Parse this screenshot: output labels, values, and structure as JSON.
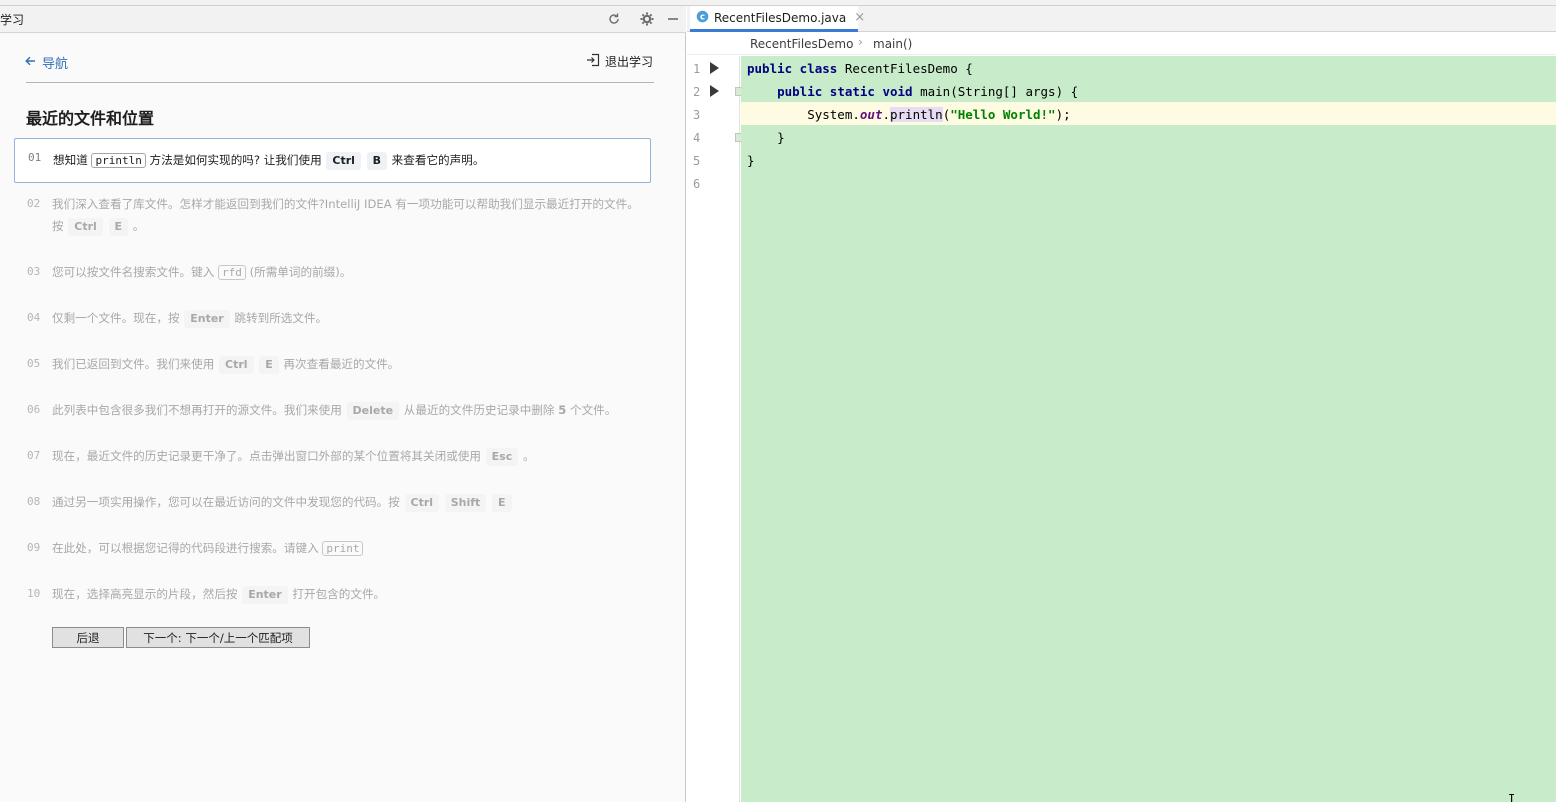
{
  "learn": {
    "panel_title": "学习",
    "nav_back": "导航",
    "exit": "退出学习",
    "lesson_title": "最近的文件和位置",
    "steps": [
      {
        "num": "01"
      },
      {
        "num": "02",
        "text_a": "我们深入查看了库文件。怎样才能返回到我们的文件?IntelliJ IDEA 有一项功能可以帮助我们显示最近打开的文件。按",
        "k1": "Ctrl",
        "k2": "E",
        "text_b": "。"
      },
      {
        "num": "03",
        "text_a": "您可以按文件名搜索文件。键入",
        "code": "rfd",
        "text_b": "(所需单词的前缀)。"
      },
      {
        "num": "04",
        "text_a": "仅剩一个文件。现在，按",
        "k1": "Enter",
        "text_b": "跳转到所选文件。"
      },
      {
        "num": "05",
        "text_a": "我们已返回到文件。我们来使用",
        "k1": "Ctrl",
        "k2": "E",
        "text_b": "再次查看最近的文件。"
      },
      {
        "num": "06",
        "text_a": "此列表中包含很多我们不想再打开的源文件。我们来使用",
        "k1": "Delete",
        "text_b": "从最近的文件历史记录中删除",
        "bold": "5",
        "text_c": "个文件。"
      },
      {
        "num": "07",
        "text_a": "现在，最近文件的历史记录更干净了。点击弹出窗口外部的某个位置将其关闭或使用",
        "k1": "Esc",
        "text_b": "。"
      },
      {
        "num": "08",
        "text_a": "通过另一项实用操作，您可以在最近访问的文件中发现您的代码。按",
        "k1": "Ctrl",
        "k2": "Shift",
        "k3": "E"
      },
      {
        "num": "09",
        "text_a": "在此处，可以根据您记得的代码段进行搜索。请键入",
        "code": "print"
      },
      {
        "num": "10",
        "text_a": "现在，选择高亮显示的片段，然后按",
        "k1": "Enter",
        "text_b": "打开包含的文件。"
      }
    ],
    "active_step": {
      "text_a": "想知道",
      "code": "println",
      "text_b": "方法是如何实现的吗? 让我们使用",
      "k1": "Ctrl",
      "k2": "B",
      "text_c": "来查看它的声明。"
    },
    "back_button": "后退",
    "next_button": "下一个: 下一个/上一个匹配项"
  },
  "editor": {
    "tab_label": "RecentFilesDemo.java",
    "tab_close": "×",
    "breadcrumb_class": "RecentFilesDemo",
    "breadcrumb_sep": "›",
    "breadcrumb_method": "main()",
    "line_numbers": [
      "1",
      "2",
      "3",
      "4",
      "5",
      "6"
    ],
    "code": {
      "l1_kw": "public class",
      "l1_rest": " RecentFilesDemo {",
      "l2_indent": "    ",
      "l2_kw": "public static void",
      "l2_rest": " main(String[] args) {",
      "l3_a": "        System.",
      "l3_field": "out",
      "l3_dot": ".",
      "l3_method": "println",
      "l3_paren": "(",
      "l3_str": "\"Hello World!\"",
      "l3_end": ");",
      "l4": "    }",
      "l5": "}"
    },
    "caret_glyph": "I"
  },
  "colors": {
    "accent": "#3b7bd5",
    "code_bg": "#c8ecca",
    "current_line": "#fdfbe1",
    "keyword": "#000080",
    "string": "#008000",
    "field": "#660e7a"
  },
  "icons": [
    "arrow-left-icon",
    "exit-icon",
    "refresh-icon",
    "gear-icon",
    "minimize-icon",
    "java-class-icon",
    "run-icon",
    "fold-icon"
  ]
}
